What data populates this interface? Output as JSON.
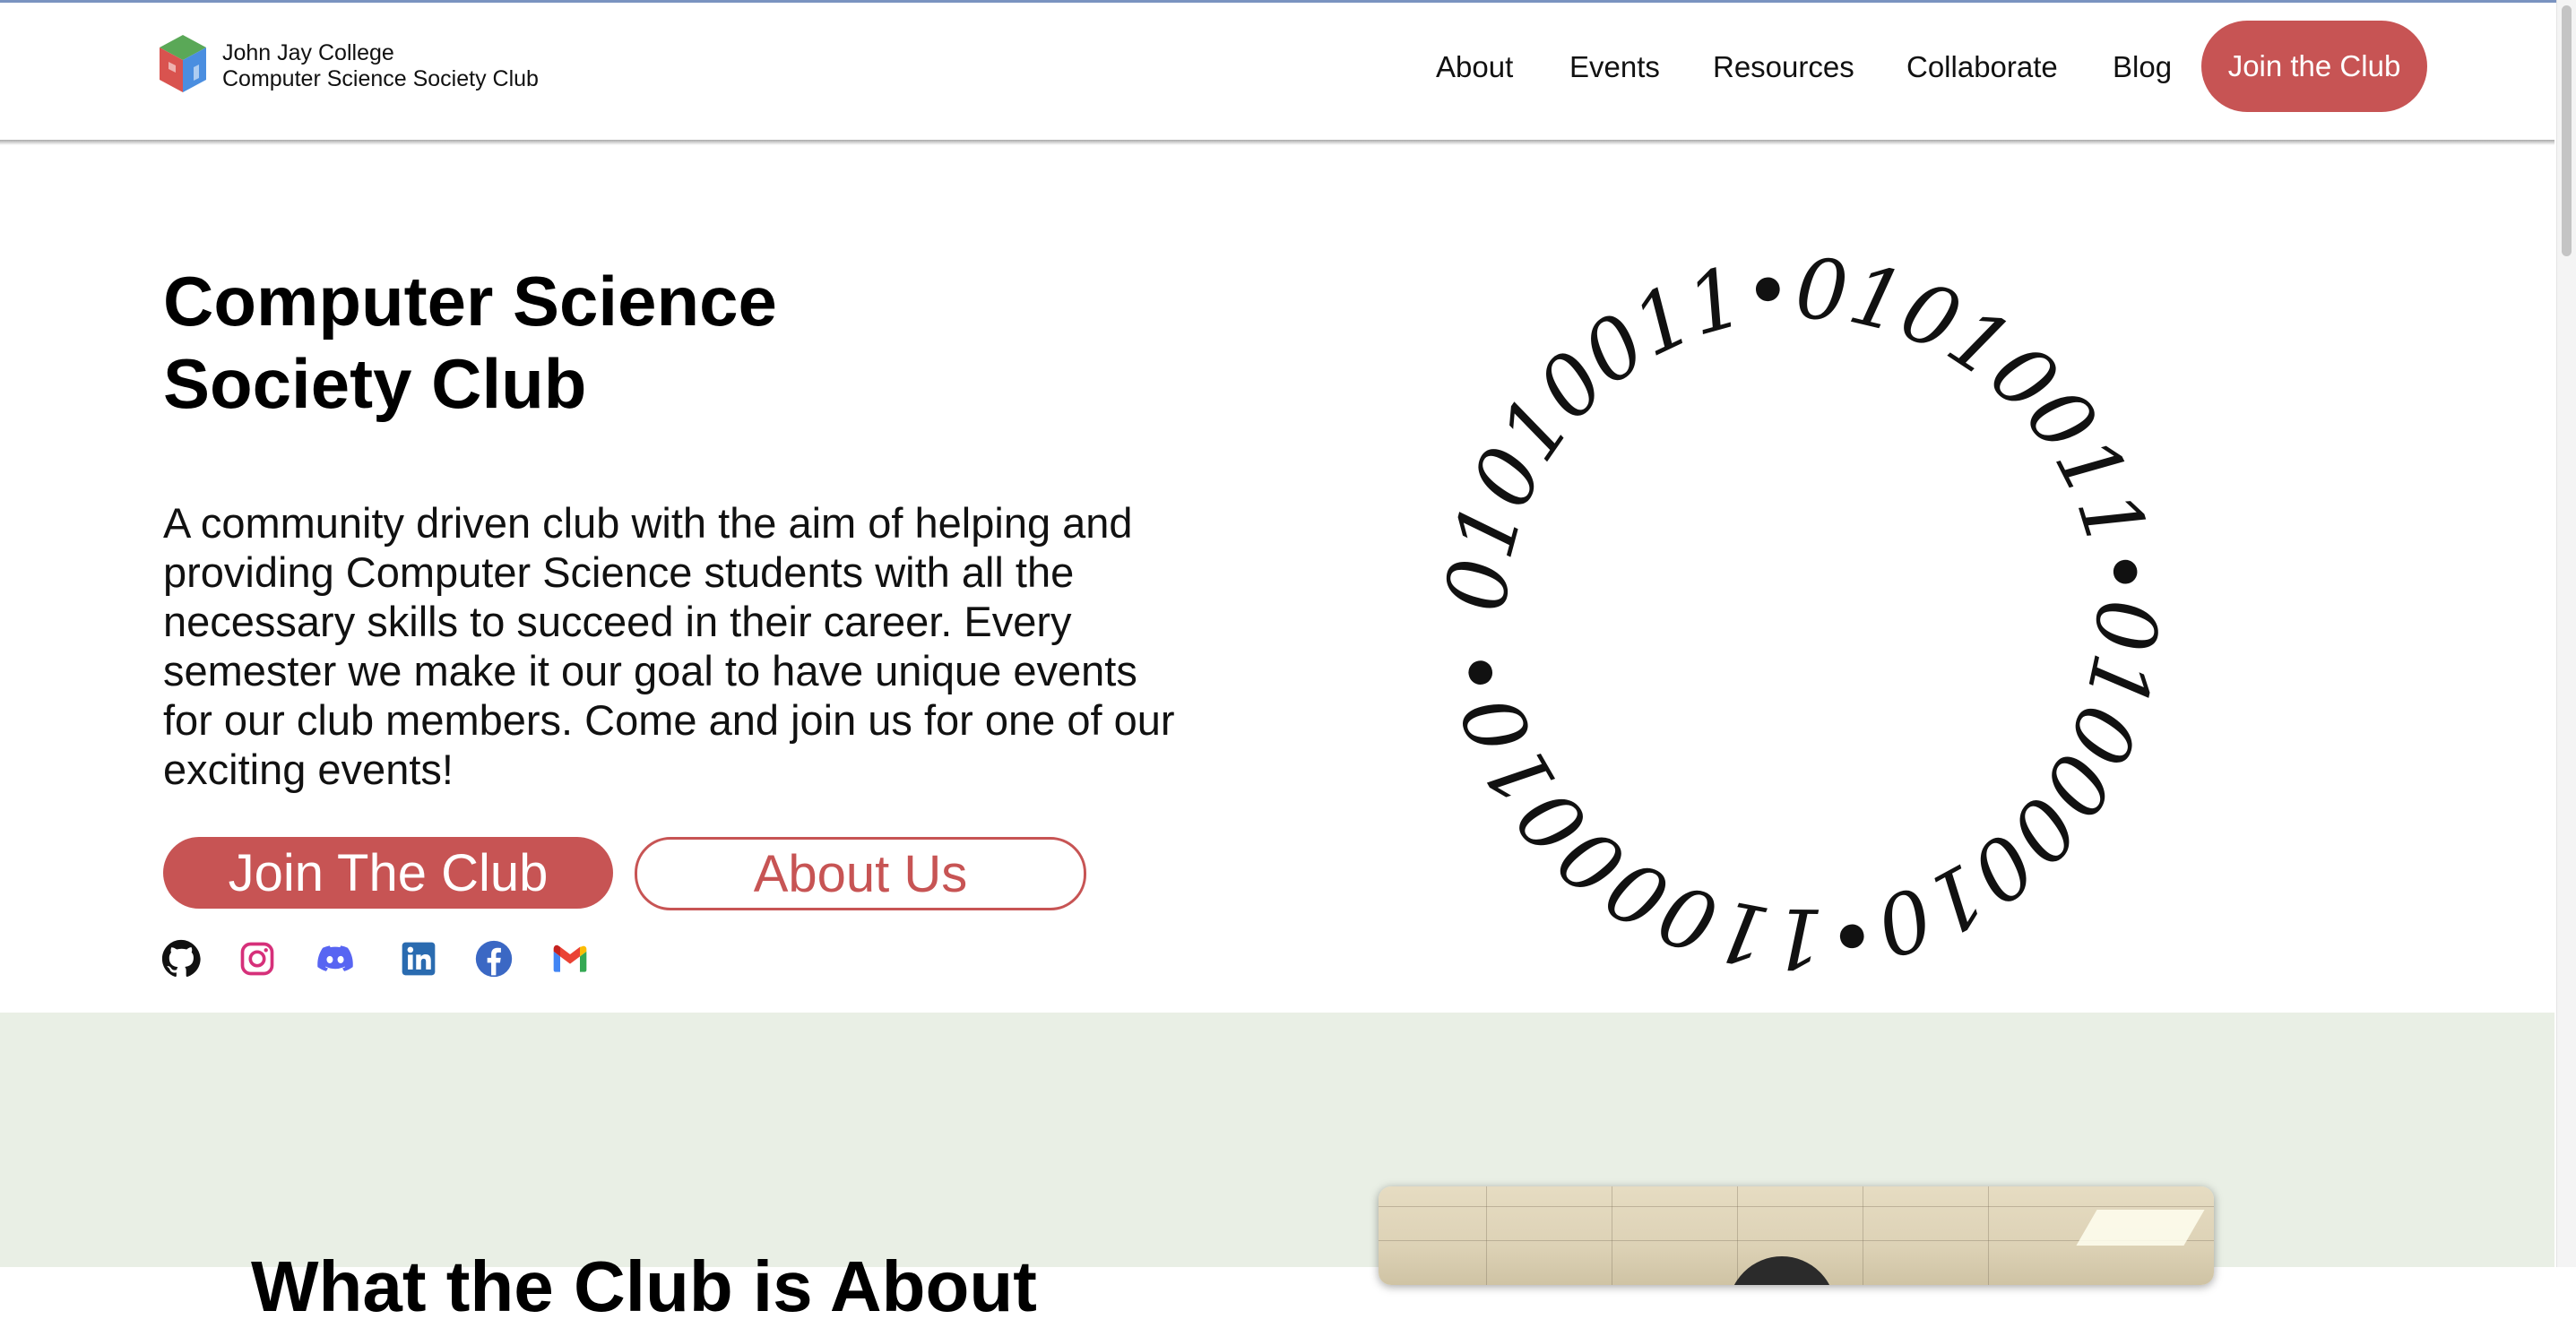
{
  "brand": {
    "line1": "John Jay College",
    "line2": "Computer Science Society Club"
  },
  "nav": {
    "items": [
      {
        "label": "About"
      },
      {
        "label": "Events"
      },
      {
        "label": "Resources"
      },
      {
        "label": "Collaborate"
      },
      {
        "label": "Blog"
      }
    ],
    "cta_label": "Join the Club"
  },
  "hero": {
    "title_line1": "Computer Science",
    "title_line2": "Society Club",
    "description": "A community driven club with the aim of helping and providing Computer Science students with all the necessary skills to succeed in their career. Every semester we make it our goal to have unique events for our club members. Come and join us for one of our exciting events!",
    "primary_button": "Join The Club",
    "secondary_button": "About Us",
    "binary_ring": "01010011•01010011•01000010•11000010•"
  },
  "social": [
    {
      "icon": "github-icon"
    },
    {
      "icon": "instagram-icon"
    },
    {
      "icon": "discord-icon"
    },
    {
      "icon": "linkedin-icon"
    },
    {
      "icon": "facebook-icon"
    },
    {
      "icon": "gmail-icon"
    }
  ],
  "section2": {
    "title": "What the Club is About"
  },
  "colors": {
    "accent": "#c75454",
    "section_bg": "#e9efe5"
  }
}
